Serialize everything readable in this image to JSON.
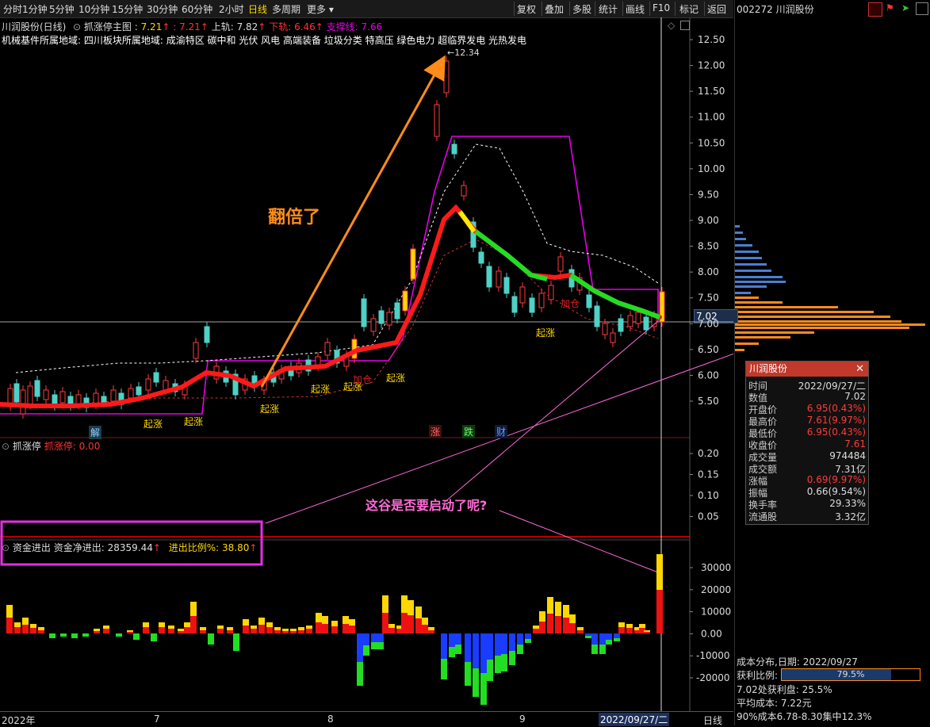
{
  "toolbar": {
    "periods": [
      "分时",
      "1分钟",
      "5分钟",
      "10分钟",
      "15分钟",
      "30分钟",
      "60分钟",
      "2小时",
      "日线",
      "多周期",
      "更多"
    ],
    "active_period": "日线",
    "right_buttons": [
      "复权",
      "叠加",
      "多股",
      "统计",
      "画线",
      "F10",
      "标记",
      "返回"
    ]
  },
  "right_panel": {
    "title": "002272 川润股份",
    "price_tag": "7.02",
    "dist_title": "成本分布,日期:",
    "dist_date": "2022/09/27",
    "profit_ratio_label": "获利比例:",
    "profit_ratio": "79.5%",
    "profit_ratio_value": 0.795,
    "line1": "7.02处获利盘: 25.5%",
    "line2": "平均成本: 7.22元",
    "line3": "90%成本6.78-8.30集中12.3%"
  },
  "header": {
    "stock": "川润股份(日线)",
    "indicator": "抓涨停主图",
    "ind_v1": "7.21",
    "ind_v2": "7.21",
    "upper_label": "上轨:",
    "upper_val": "7.82",
    "lower_label": "下轨:",
    "lower_val": "6.46",
    "support_label": "支撑线:",
    "support_val": "7.66",
    "sector_line": "机械基件所属地域: 四川板块所属地域: 成渝特区 碳中和 光伏 风电 高端装备 垃圾分类 特高压 绿色电力 超临界发电 光热发电"
  },
  "annotations": {
    "doubled": "翻倍了",
    "question": "这谷是否要启动了呢?",
    "peak_price": "12.34",
    "qizhang": "起涨",
    "jiacang": "加仓",
    "jie": "解",
    "zhang": "涨",
    "die": "跌",
    "cai": "财"
  },
  "price_axis": [
    "12.50",
    "12.00",
    "11.50",
    "11.00",
    "10.50",
    "10.00",
    "9.50",
    "9.00",
    "8.50",
    "8.00",
    "7.50",
    "7.00",
    "6.50",
    "6.00",
    "5.50"
  ],
  "sub1": {
    "name": "抓涨停",
    "label": "抓涨停:",
    "value": "0.00",
    "axis": [
      "0.20",
      "0.15",
      "0.10",
      "0.05"
    ]
  },
  "sub2": {
    "name": "资金进出",
    "net_label": "资金净进出:",
    "net_value": "28359.44",
    "ratio_label": "进出比例%:",
    "ratio_value": "38.80",
    "axis": [
      "30000",
      "20000",
      "10000",
      "0.00",
      "-10000",
      "-20000"
    ]
  },
  "bottom_axis": {
    "labels": [
      "2022年",
      "7",
      "8",
      "9"
    ],
    "current": "2022/09/27/二",
    "period": "日线"
  },
  "infobox": {
    "title": "川润股份",
    "rows": [
      {
        "k": "时间",
        "v": "2022/09/27/二",
        "c": "n"
      },
      {
        "k": "数值",
        "v": "7.02",
        "c": "n"
      },
      {
        "k": "开盘价",
        "v": "6.95(0.43%)",
        "c": "r"
      },
      {
        "k": "最高价",
        "v": "7.61(9.97%)",
        "c": "r"
      },
      {
        "k": "最低价",
        "v": "6.95(0.43%)",
        "c": "r"
      },
      {
        "k": "收盘价",
        "v": "7.61",
        "c": "r"
      },
      {
        "k": "成交量",
        "v": "974484",
        "c": "n"
      },
      {
        "k": "成交额",
        "v": "7.31亿",
        "c": "n"
      },
      {
        "k": "涨幅",
        "v": "0.69(9.97%)",
        "c": "r"
      },
      {
        "k": "振幅",
        "v": "0.66(9.54%)",
        "c": "n"
      },
      {
        "k": "换手率",
        "v": "29.33%",
        "c": "n"
      },
      {
        "k": "流通股",
        "v": "3.32亿",
        "c": "n"
      }
    ]
  },
  "colors": {
    "up": "#ff3b3b",
    "down": "#4fd1c5",
    "magenta": "#e600e6",
    "orange": "#ff8c1a",
    "pink": "#ff6ad5",
    "yellow": "#ffd700"
  }
}
